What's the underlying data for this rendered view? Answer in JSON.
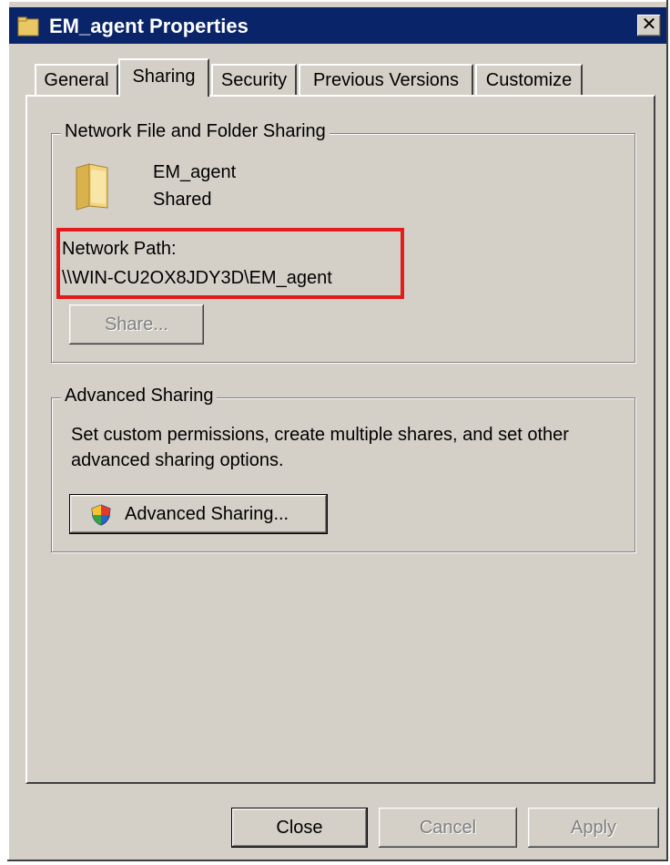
{
  "window": {
    "title": "EM_agent Properties",
    "close_glyph": "✕"
  },
  "tabs": [
    {
      "label": "General",
      "active": false
    },
    {
      "label": "Sharing",
      "active": true
    },
    {
      "label": "Security",
      "active": false
    },
    {
      "label": "Previous Versions",
      "active": false
    },
    {
      "label": "Customize",
      "active": false
    }
  ],
  "network_sharing": {
    "group_label": "Network File and Folder Sharing",
    "folder_name": "EM_agent",
    "status": "Shared",
    "path_label": "Network Path:",
    "path_value": "\\\\WIN-CU2OX8JDY3D\\EM_agent",
    "share_button": "Share...",
    "share_enabled": false,
    "highlight_color": "#e21b1b"
  },
  "advanced_sharing": {
    "group_label": "Advanced Sharing",
    "description_line1": "Set custom permissions, create multiple shares, and set other",
    "description_line2": "advanced sharing options.",
    "button_label": "Advanced Sharing..."
  },
  "footer": {
    "close": "Close",
    "cancel": "Cancel",
    "apply": "Apply",
    "cancel_enabled": false,
    "apply_enabled": false
  },
  "icons": {
    "title_icon": "folder-icon",
    "folder_icon": "folder-icon",
    "shield_icon": "uac-shield-icon"
  },
  "colors": {
    "title_bar": "#0a246a",
    "dialog_bg": "#d4d0c8"
  }
}
